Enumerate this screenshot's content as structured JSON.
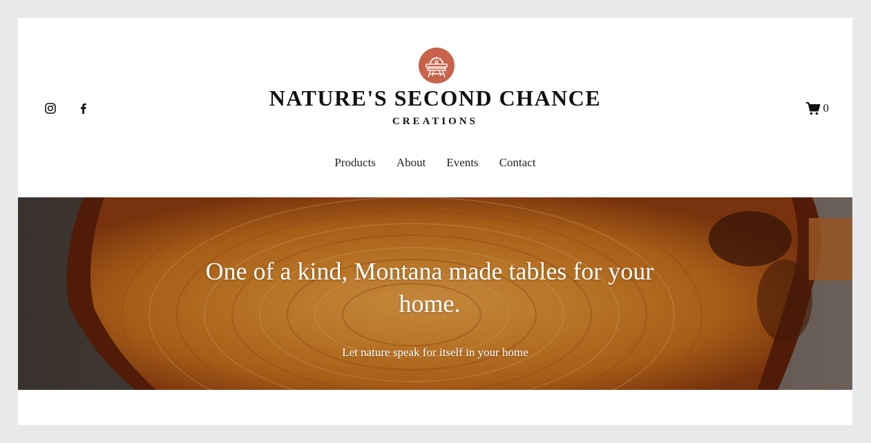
{
  "brand": {
    "title": "NATURE'S SECOND CHANCE",
    "subtitle": "CREATIONS",
    "badge_icon": "sawmill-badge-icon",
    "badge_color": "#c8624a"
  },
  "social": {
    "instagram_icon": "instagram-icon",
    "facebook_icon": "facebook-icon"
  },
  "cart": {
    "icon": "cart-icon",
    "count": "0"
  },
  "nav": {
    "items": [
      {
        "label": "Products"
      },
      {
        "label": "About"
      },
      {
        "label": "Events"
      },
      {
        "label": "Contact"
      }
    ]
  },
  "hero": {
    "title": "One of a kind, Montana made tables for your home.",
    "subtitle": "Let nature speak for itself in your home",
    "wood_color": "#c9741f"
  }
}
